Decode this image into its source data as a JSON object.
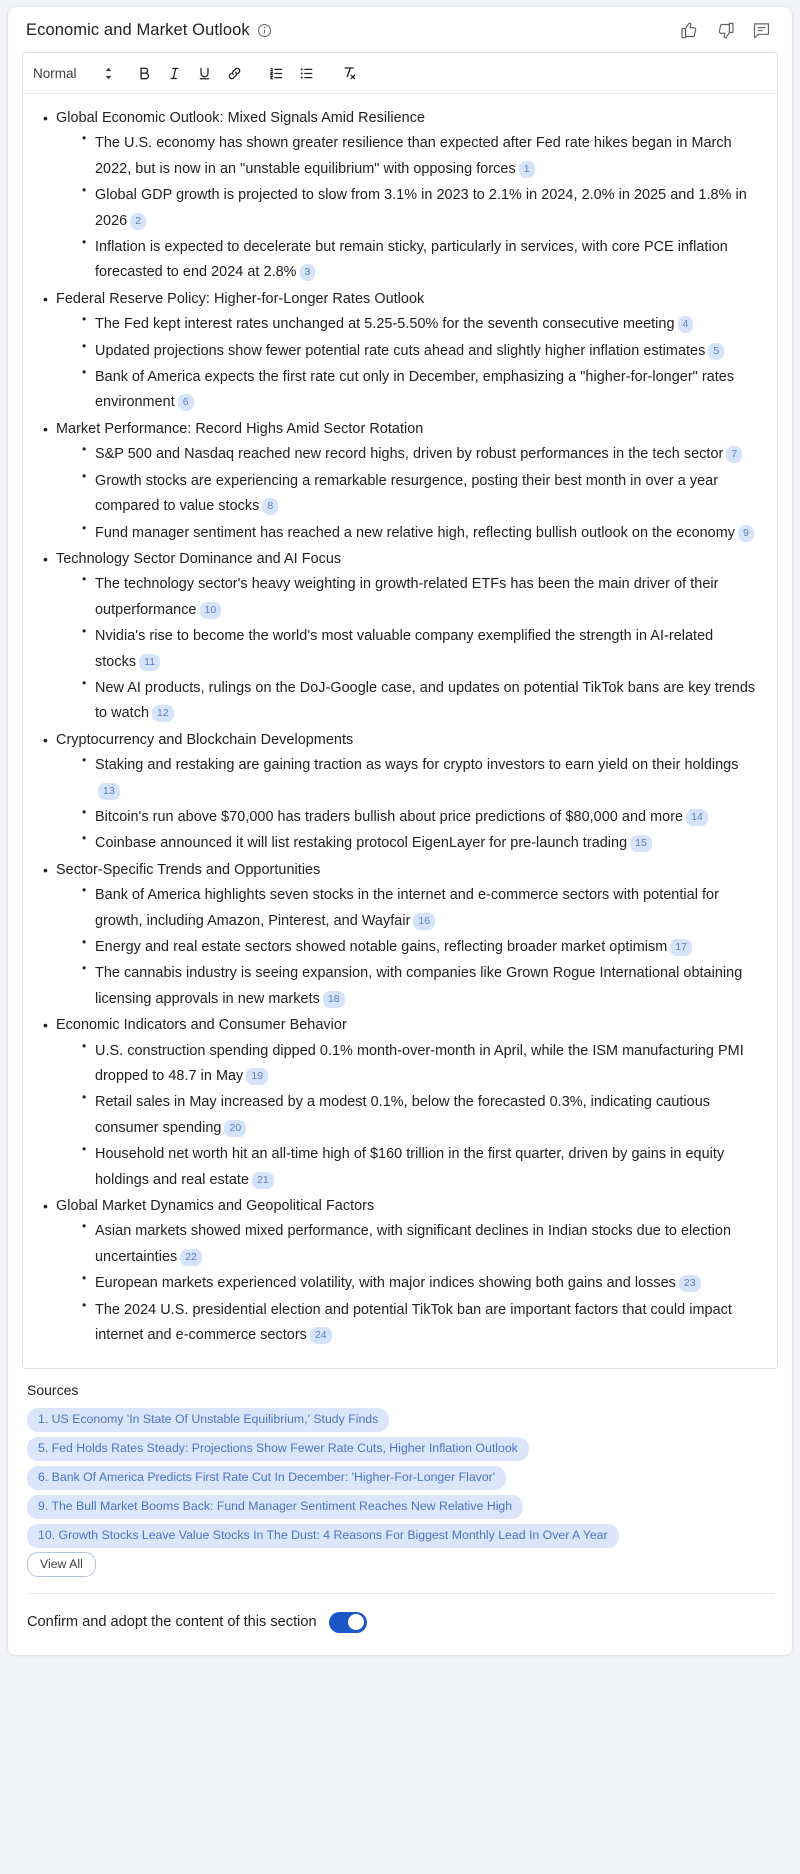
{
  "header": {
    "title": "Economic and Market Outlook",
    "info_icon": "info-icon",
    "actions": [
      {
        "name": "thumbs-up-icon",
        "label": "Thumbs up"
      },
      {
        "name": "thumbs-down-icon",
        "label": "Thumbs down"
      },
      {
        "name": "comment-icon",
        "label": "Comment"
      }
    ]
  },
  "toolbar": {
    "style_label": "Normal",
    "buttons": [
      {
        "name": "bold-button",
        "label": "B"
      },
      {
        "name": "italic-button",
        "label": "I"
      },
      {
        "name": "underline-button",
        "label": "U"
      },
      {
        "name": "link-button",
        "label": "Link"
      },
      {
        "name": "ordered-list-button",
        "label": "Ordered list"
      },
      {
        "name": "bullet-list-button",
        "label": "Bullet list"
      },
      {
        "name": "clear-format-button",
        "label": "Clear formatting"
      }
    ]
  },
  "document": {
    "sections": [
      {
        "heading": "Global Economic Outlook: Mixed Signals Amid Resilience",
        "bullets": [
          {
            "text": "The U.S. economy has shown greater resilience than expected after Fed rate hikes began in March 2022, but is now in an \"unstable equilibrium\" with opposing forces",
            "cite": "1"
          },
          {
            "text": "Global GDP growth is projected to slow from 3.1% in 2023 to 2.1% in 2024, 2.0% in 2025 and 1.8% in 2026",
            "cite": "2"
          },
          {
            "text": "Inflation is expected to decelerate but remain sticky, particularly in services, with core PCE inflation forecasted to end 2024 at 2.8%",
            "cite": "3"
          }
        ]
      },
      {
        "heading": "Federal Reserve Policy: Higher-for-Longer Rates Outlook",
        "bullets": [
          {
            "text": "The Fed kept interest rates unchanged at 5.25-5.50% for the seventh consecutive meeting",
            "cite": "4"
          },
          {
            "text": "Updated projections show fewer potential rate cuts ahead and slightly higher inflation estimates",
            "cite": "5"
          },
          {
            "text": "Bank of America expects the first rate cut only in December, emphasizing a \"higher-for-longer\" rates environment",
            "cite": "6"
          }
        ]
      },
      {
        "heading": "Market Performance: Record Highs Amid Sector Rotation",
        "bullets": [
          {
            "text": "S&P 500 and Nasdaq reached new record highs, driven by robust performances in the tech sector",
            "cite": "7"
          },
          {
            "text": "Growth stocks are experiencing a remarkable resurgence, posting their best month in over a year compared to value stocks",
            "cite": "8"
          },
          {
            "text": "Fund manager sentiment has reached a new relative high, reflecting bullish outlook on the economy",
            "cite": "9"
          }
        ]
      },
      {
        "heading": "Technology Sector Dominance and AI Focus",
        "bullets": [
          {
            "text": "The technology sector's heavy weighting in growth-related ETFs has been the main driver of their outperformance",
            "cite": "10"
          },
          {
            "text": "Nvidia's rise to become the world's most valuable company exemplified the strength in AI-related stocks",
            "cite": "11"
          },
          {
            "text": "New AI products, rulings on the DoJ-Google case, and updates on potential TikTok bans are key trends to watch",
            "cite": "12"
          }
        ]
      },
      {
        "heading": "Cryptocurrency and Blockchain Developments",
        "bullets": [
          {
            "text": "Staking and restaking are gaining traction as ways for crypto investors to earn yield on their holdings",
            "cite": "13"
          },
          {
            "text": "Bitcoin's run above $70,000 has traders bullish about price predictions of $80,000 and more",
            "cite": "14"
          },
          {
            "text": "Coinbase announced it will list restaking protocol EigenLayer for pre-launch trading",
            "cite": "15"
          }
        ]
      },
      {
        "heading": "Sector-Specific Trends and Opportunities",
        "bullets": [
          {
            "text": "Bank of America highlights seven stocks in the internet and e-commerce sectors with potential for growth, including Amazon, Pinterest, and Wayfair",
            "cite": "16"
          },
          {
            "text": "Energy and real estate sectors showed notable gains, reflecting broader market optimism",
            "cite": "17"
          },
          {
            "text": "The cannabis industry is seeing expansion, with companies like Grown Rogue International obtaining licensing approvals in new markets",
            "cite": "18"
          }
        ]
      },
      {
        "heading": "Economic Indicators and Consumer Behavior",
        "bullets": [
          {
            "text": "U.S. construction spending dipped 0.1% month-over-month in April, while the ISM manufacturing PMI dropped to 48.7 in May",
            "cite": "19"
          },
          {
            "text": "Retail sales in May increased by a modest 0.1%, below the forecasted 0.3%, indicating cautious consumer spending",
            "cite": "20"
          },
          {
            "text": "Household net worth hit an all-time high of $160 trillion in the first quarter, driven by gains in equity holdings and real estate",
            "cite": "21"
          }
        ]
      },
      {
        "heading": "Global Market Dynamics and Geopolitical Factors",
        "bullets": [
          {
            "text": "Asian markets showed mixed performance, with significant declines in Indian stocks due to election uncertainties",
            "cite": "22"
          },
          {
            "text": "European markets experienced volatility, with major indices showing both gains and losses",
            "cite": "23"
          },
          {
            "text": "The 2024 U.S. presidential election and potential TikTok ban are important factors that could impact internet and e-commerce sectors",
            "cite": "24"
          }
        ]
      }
    ]
  },
  "sources": {
    "title": "Sources",
    "items": [
      "1. US Economy 'In State Of Unstable Equilibrium,' Study Finds",
      "5. Fed Holds Rates Steady: Projections Show Fewer Rate Cuts, Higher Inflation Outlook",
      "6. Bank Of America Predicts First Rate Cut In December: 'Higher-For-Longer Flavor'",
      "9. The Bull Market Booms Back: Fund Manager Sentiment Reaches New Relative High",
      "10. Growth Stocks Leave Value Stocks In The Dust: 4 Reasons For Biggest Monthly Lead In Over A Year"
    ],
    "view_all_label": "View All"
  },
  "confirm": {
    "label": "Confirm and adopt the content of this section",
    "toggle_on": true
  },
  "colors": {
    "accent": "#1a56c4",
    "chip_bg": "#dbe6fb",
    "chip_text": "#4a75c4",
    "citation_bg": "#d6e4fb",
    "citation_text": "#5b7fbe"
  }
}
